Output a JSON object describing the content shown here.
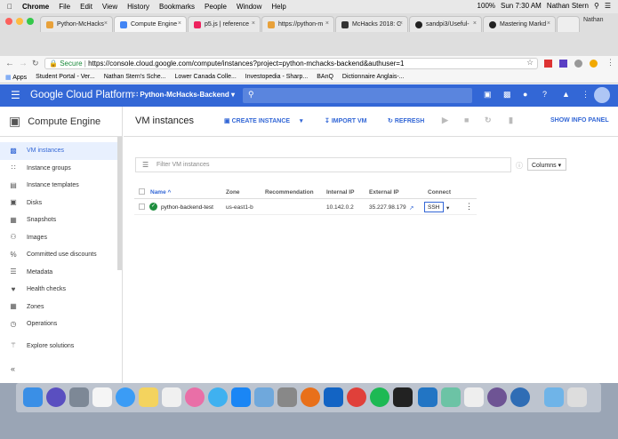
{
  "mac_menu": {
    "app": "Chrome",
    "items": [
      "File",
      "Edit",
      "View",
      "History",
      "Bookmarks",
      "People",
      "Window",
      "Help"
    ],
    "battery": "100%",
    "clock": "Sun 7:30 AM",
    "user": "Nathan Stern"
  },
  "tabs": [
    {
      "title": "Python-McHacks",
      "color": "#e8a13a"
    },
    {
      "title": "Compute Engine",
      "color": "#4285f4"
    },
    {
      "title": "p5.js | reference",
      "color": "#ed225d"
    },
    {
      "title": "https://python-m",
      "color": "#e8a13a"
    },
    {
      "title": "McHacks 2018: C",
      "color": "#333"
    },
    {
      "title": "sandpi3/Useful-",
      "color": "#222"
    },
    {
      "title": "Mastering Markd",
      "color": "#222"
    }
  ],
  "profile_tab": "Nathan",
  "url": {
    "secure_label": "Secure",
    "url": "https://console.cloud.google.com/compute/instances?project=python-mchacks-backend&authuser=1"
  },
  "bookmarks": [
    "Apps",
    "Student Portal - Ver...",
    "Nathan Stern's Sche...",
    "Lower Canada Colle...",
    "Investopedia - Sharp...",
    "BAnQ",
    "Dictionnaire Anglais-..."
  ],
  "gcp": {
    "brand": "Google Cloud Platform",
    "project": "Python-McHacks-Backend"
  },
  "sidebar": {
    "title": "Compute Engine",
    "items": [
      {
        "label": "VM instances",
        "icon": "vm-icon"
      },
      {
        "label": "Instance groups",
        "icon": "group-icon"
      },
      {
        "label": "Instance templates",
        "icon": "template-icon"
      },
      {
        "label": "Disks",
        "icon": "disk-icon"
      },
      {
        "label": "Snapshots",
        "icon": "snapshot-icon"
      },
      {
        "label": "Images",
        "icon": "image-icon"
      },
      {
        "label": "Committed use discounts",
        "icon": "discount-icon"
      },
      {
        "label": "Metadata",
        "icon": "metadata-icon"
      },
      {
        "label": "Health checks",
        "icon": "health-icon"
      },
      {
        "label": "Zones",
        "icon": "zones-icon"
      },
      {
        "label": "Operations",
        "icon": "operations-icon"
      },
      {
        "label": "Explore solutions",
        "icon": "solutions-icon"
      }
    ]
  },
  "main": {
    "title": "VM instances",
    "create": "CREATE INSTANCE",
    "import": "IMPORT VM",
    "refresh": "REFRESH",
    "show_info": "SHOW INFO PANEL",
    "filter_placeholder": "Filter VM instances",
    "columns": "Columns"
  },
  "table": {
    "headers": [
      "Name",
      "Zone",
      "Recommendation",
      "Internal IP",
      "External IP",
      "Connect"
    ],
    "rows": [
      {
        "name": "python-backend-test",
        "zone": "us-east1-b",
        "recommendation": "",
        "internal_ip": "10.142.0.2",
        "external_ip": "35.227.98.179",
        "connect": "SSH"
      }
    ]
  }
}
